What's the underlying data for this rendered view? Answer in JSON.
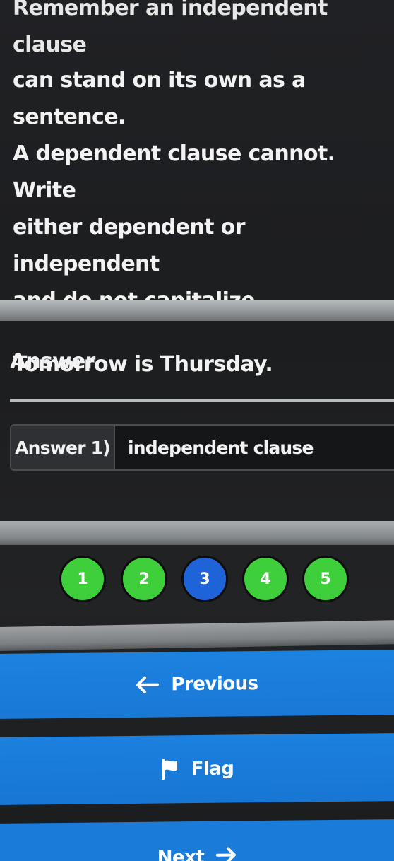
{
  "question": {
    "partial_top_line": "Remember an independent clause",
    "instructions": "can stand on its own as a sentence.\nA dependent clause cannot. Write\neither dependent or independent\nand do not capitalize.",
    "prompt": "Tomorrow is Thursday."
  },
  "answer_section": {
    "heading": "Answer",
    "label": "Answer 1)",
    "value": "independent clause"
  },
  "pagination": {
    "current": 3,
    "pages": [
      {
        "label": "1",
        "status": "answered",
        "color": "#3ecf3a"
      },
      {
        "label": "2",
        "status": "answered",
        "color": "#3ecf3a"
      },
      {
        "label": "3",
        "status": "current",
        "color": "#1f63d8"
      },
      {
        "label": "4",
        "status": "answered",
        "color": "#3ecf3a"
      },
      {
        "label": "5",
        "status": "answered",
        "color": "#3ecf3a"
      }
    ]
  },
  "buttons": {
    "previous": {
      "label": "Previous",
      "icon": "arrow-left-icon"
    },
    "flag": {
      "label": "Flag",
      "icon": "flag-icon"
    },
    "next": {
      "label": "Next",
      "icon": "arrow-right-icon"
    }
  },
  "colors": {
    "background": "#1e1f21",
    "button_blue": "#1a7bd8",
    "page_answered": "#3ecf3a",
    "page_current": "#1f63d8"
  }
}
